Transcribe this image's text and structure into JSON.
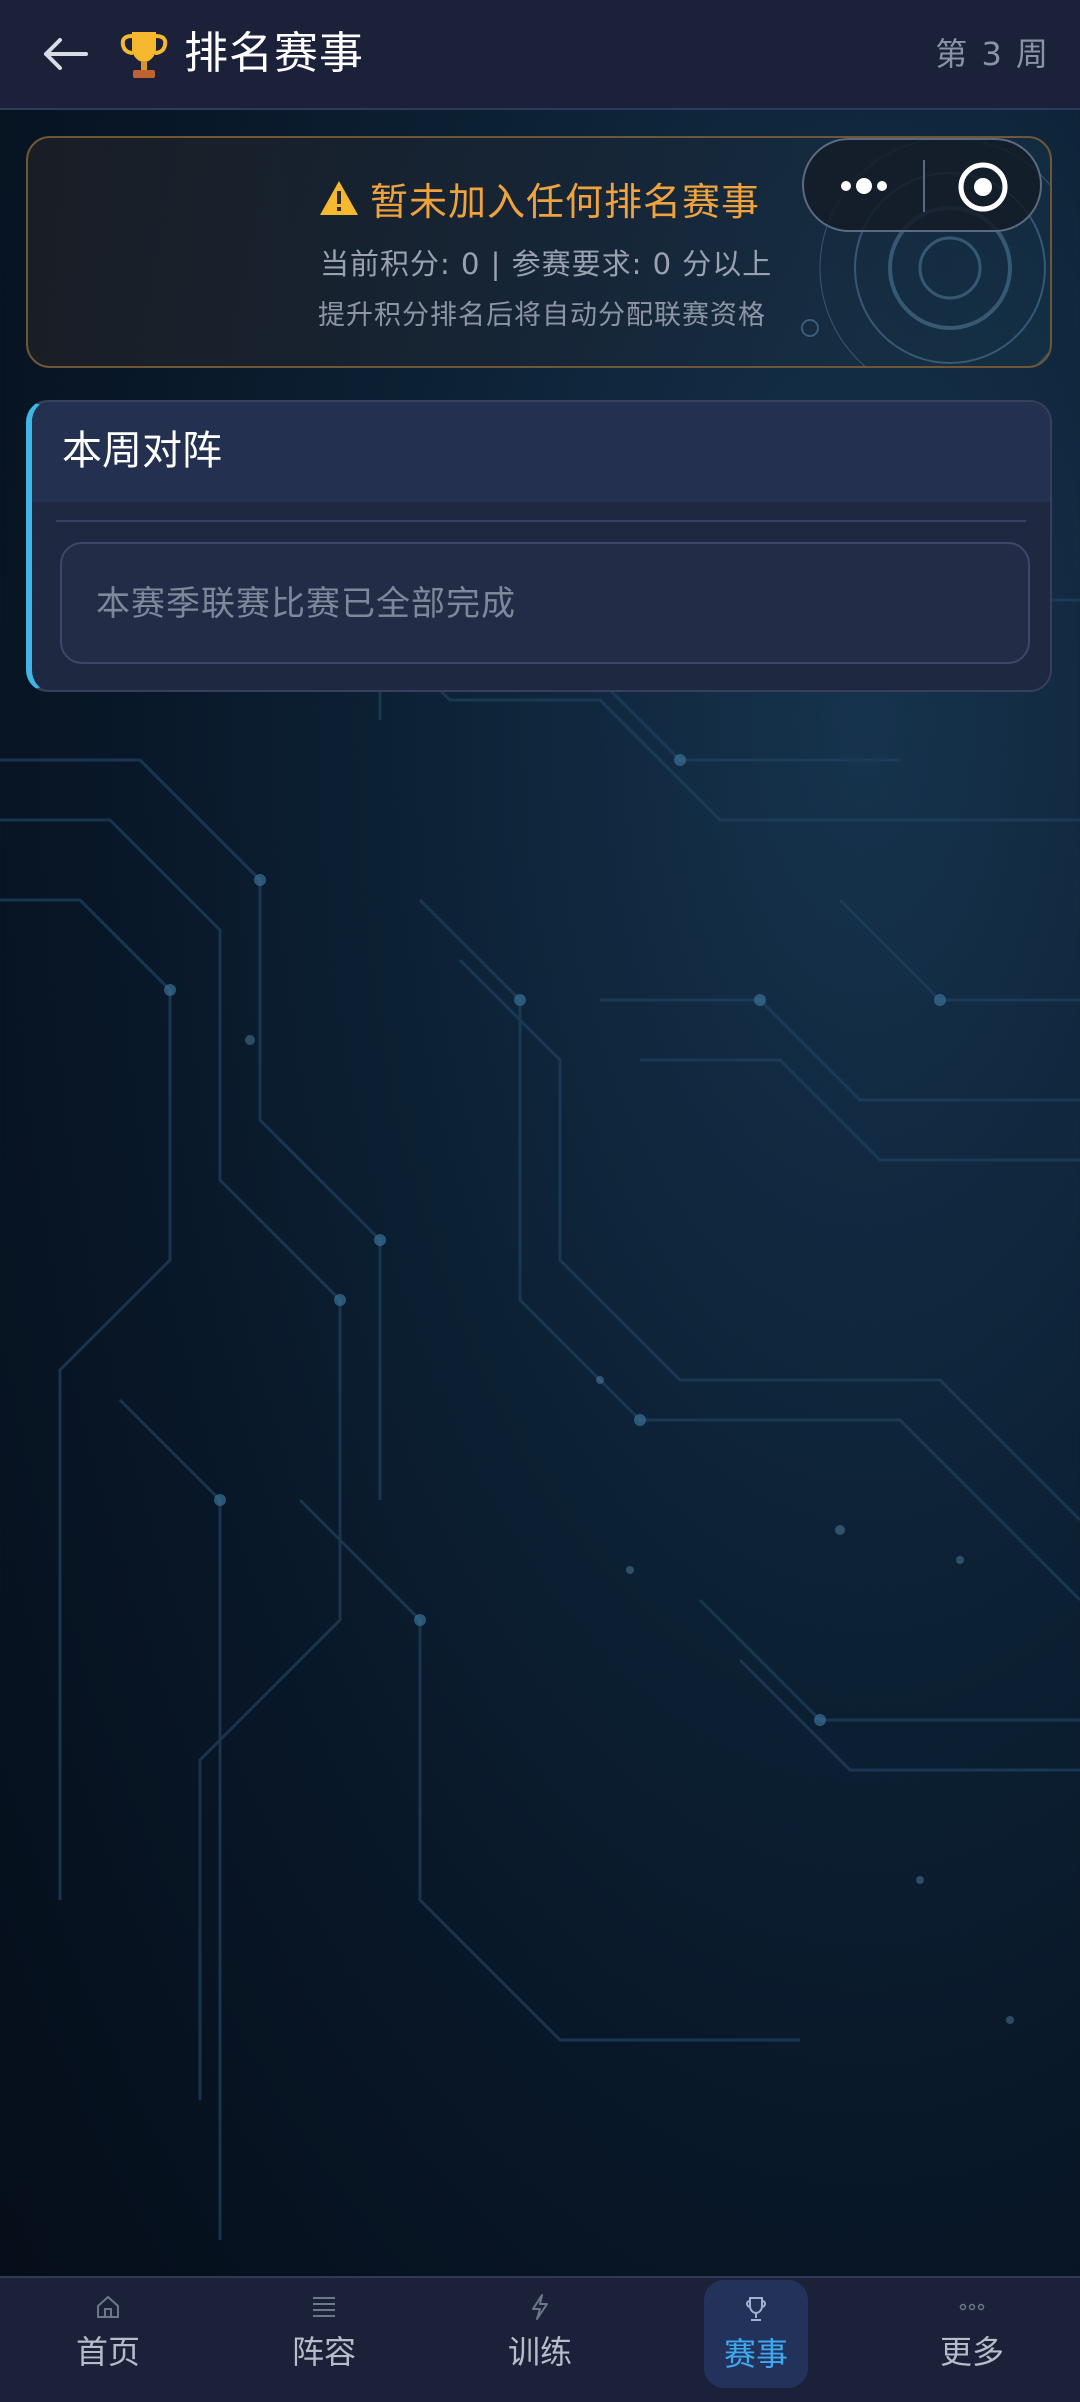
{
  "header": {
    "title": "排名赛事",
    "week_label": "第 3 周"
  },
  "notice": {
    "title": "暂未加入任何排名赛事",
    "points_line": "当前积分: 0 | 参赛要求: 0 分以上",
    "hint": "提升积分排名后将自动分配联赛资格"
  },
  "matchup": {
    "title": "本周对阵",
    "empty_text": "本赛季联赛比赛已全部完成"
  },
  "tabs": [
    {
      "label": "首页",
      "icon": "home-icon"
    },
    {
      "label": "阵容",
      "icon": "roster-icon"
    },
    {
      "label": "训练",
      "icon": "training-icon"
    },
    {
      "label": "赛事",
      "icon": "trophy-icon",
      "active": true
    },
    {
      "label": "更多",
      "icon": "more-icon"
    }
  ],
  "colors": {
    "accent": "#3ea9f0",
    "warning": "#f0a33c",
    "header_bg": "#1b2138",
    "panel_bg": "#1f2841",
    "panel_accent": "#3fb6e6"
  }
}
